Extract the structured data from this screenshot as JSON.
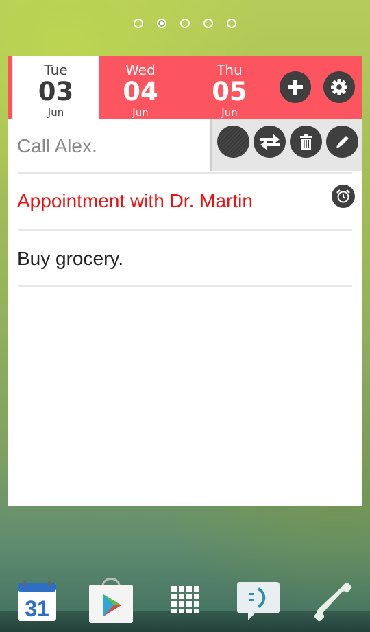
{
  "pager": {
    "count": 5,
    "active_index": 1
  },
  "days": [
    {
      "name": "Tue",
      "num": "03",
      "month": "Jun",
      "selected": true
    },
    {
      "name": "Wed",
      "num": "04",
      "month": "Jun",
      "selected": false
    },
    {
      "name": "Thu",
      "num": "05",
      "month": "Jun",
      "selected": false
    }
  ],
  "toolbar": {
    "add_icon": "plus-icon",
    "settings_icon": "gear-icon"
  },
  "tasks": [
    {
      "text": "Call Alex.",
      "color": "#888888",
      "has_actions": true
    },
    {
      "text": "Appointment with Dr. Martin",
      "color": "#ee1111",
      "has_alarm": true
    },
    {
      "text": "Buy grocery.",
      "color": "#222222"
    }
  ],
  "task_actions": [
    "color-icon",
    "swap-icon",
    "trash-icon",
    "pencil-icon"
  ],
  "colors": {
    "accent": "#fc5560",
    "button": "#3f3f3f"
  },
  "calendar_date": "31",
  "dock": [
    "calendar-icon",
    "play-store-icon",
    "apps-icon",
    "messaging-icon",
    "phone-icon"
  ]
}
